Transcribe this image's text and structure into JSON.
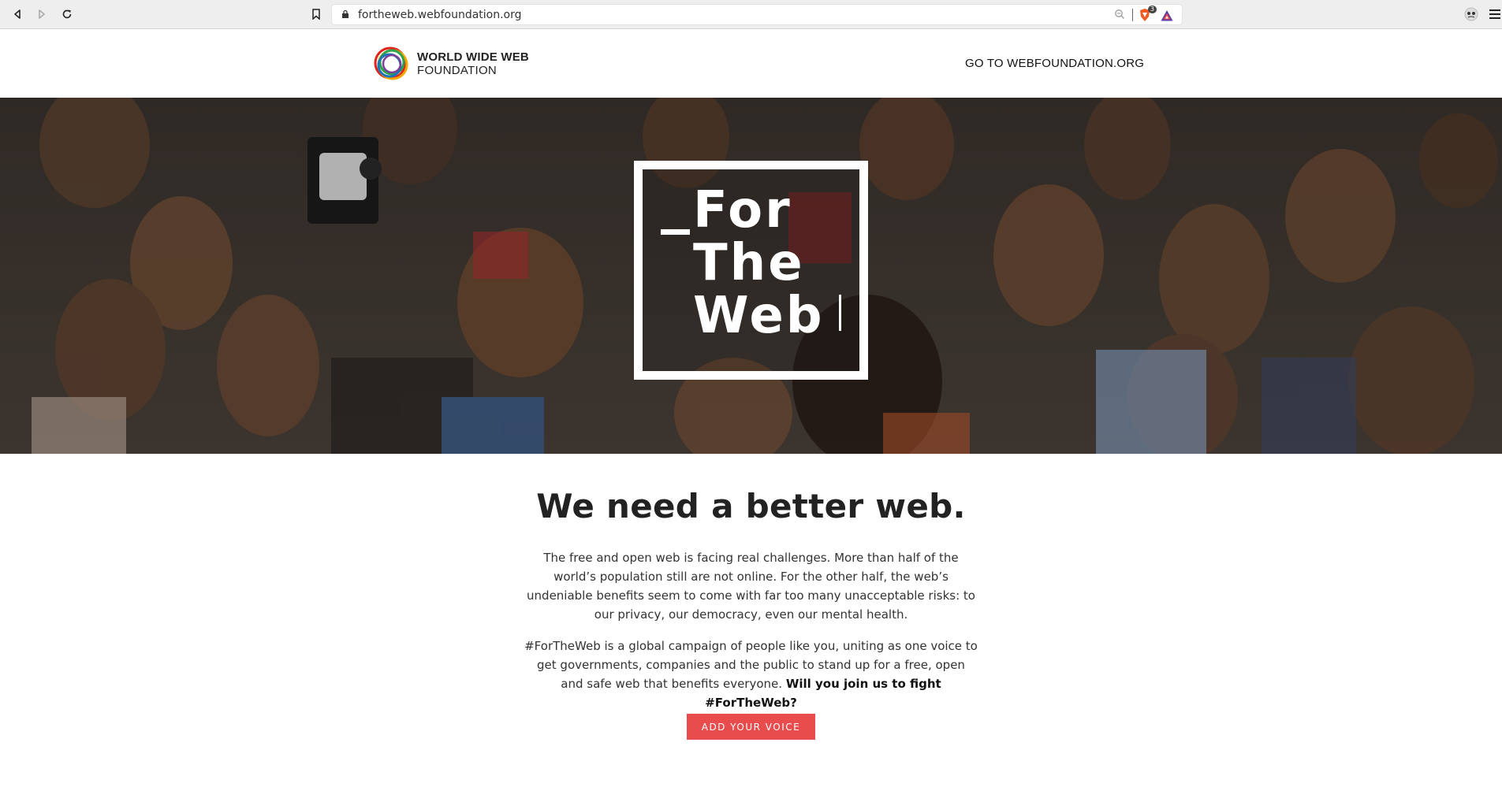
{
  "browser": {
    "url": "fortheweb.webfoundation.org",
    "shield_count": "3",
    "icons": [
      "back-icon",
      "forward-icon",
      "reload-icon",
      "bookmark-icon",
      "lock-icon",
      "zoom-icon",
      "brave-shield-icon",
      "brave-rewards-icon",
      "extension-icon",
      "menu-icon"
    ]
  },
  "header": {
    "logo_line1": "WORLD WIDE WEB",
    "logo_line2": "FOUNDATION",
    "link_label": "GO TO WEBFOUNDATION.ORG"
  },
  "hero": {
    "words": [
      "For",
      "The",
      "Web"
    ]
  },
  "main": {
    "headline": "We need a better web.",
    "paragraph1": "The free and open web is facing real challenges. More than half of the world’s population still are not online. For the other half, the web’s undeniable benefits seem to come with far too many unacceptable risks: to our privacy, our democracy, even our mental health.",
    "paragraph2_text": "#ForTheWeb is a global campaign of people like you, uniting as one voice to get governments, companies and the public to stand up for a free, open and safe web that benefits everyone.",
    "paragraph2_bold": "Will you join us to fight #ForTheWeb?",
    "cta_label": "ADD YOUR VOICE"
  },
  "colors": {
    "cta": "#e84c4c",
    "logo_ring_colors": [
      "#e2231a",
      "#f7a800",
      "#2ba24c",
      "#1b75bb",
      "#7b3f98"
    ]
  }
}
